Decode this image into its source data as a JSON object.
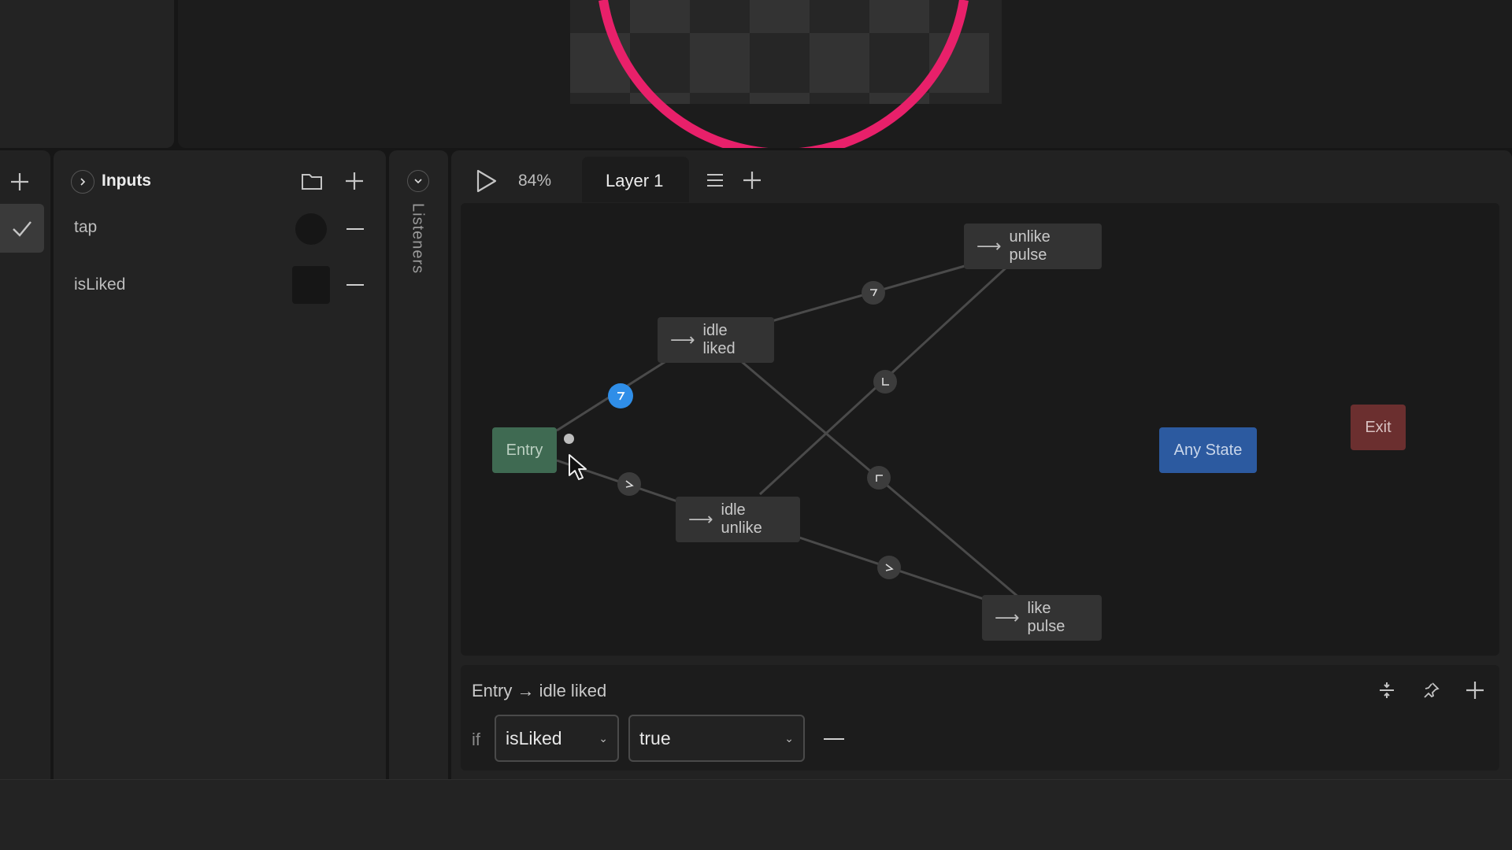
{
  "inputs_panel": {
    "title": "Inputs",
    "items": [
      {
        "name": "tap",
        "kind": "trigger"
      },
      {
        "name": "isLiked",
        "kind": "boolean"
      }
    ]
  },
  "listeners": {
    "label": "Listeners"
  },
  "toolbar": {
    "zoom": "84%"
  },
  "layer_tab": {
    "label": "Layer 1"
  },
  "graph": {
    "nodes": {
      "entry": "Entry",
      "idle_liked": "idle liked",
      "idle_unlike": "idle unlike",
      "unlike_pulse": "unlike pulse",
      "like_pulse": "like pulse",
      "any_state": "Any State",
      "exit": "Exit"
    },
    "colors": {
      "entry": "#3f6a52",
      "any_state": "#2c5aa0",
      "exit": "#6b2f2f",
      "selected_transition": "#2f8ee8",
      "artboard_ring": "#e8206a"
    }
  },
  "transition": {
    "title": "Entry → idle liked",
    "condition_keyword": "if",
    "input_value": "isLiked",
    "value": "true"
  }
}
